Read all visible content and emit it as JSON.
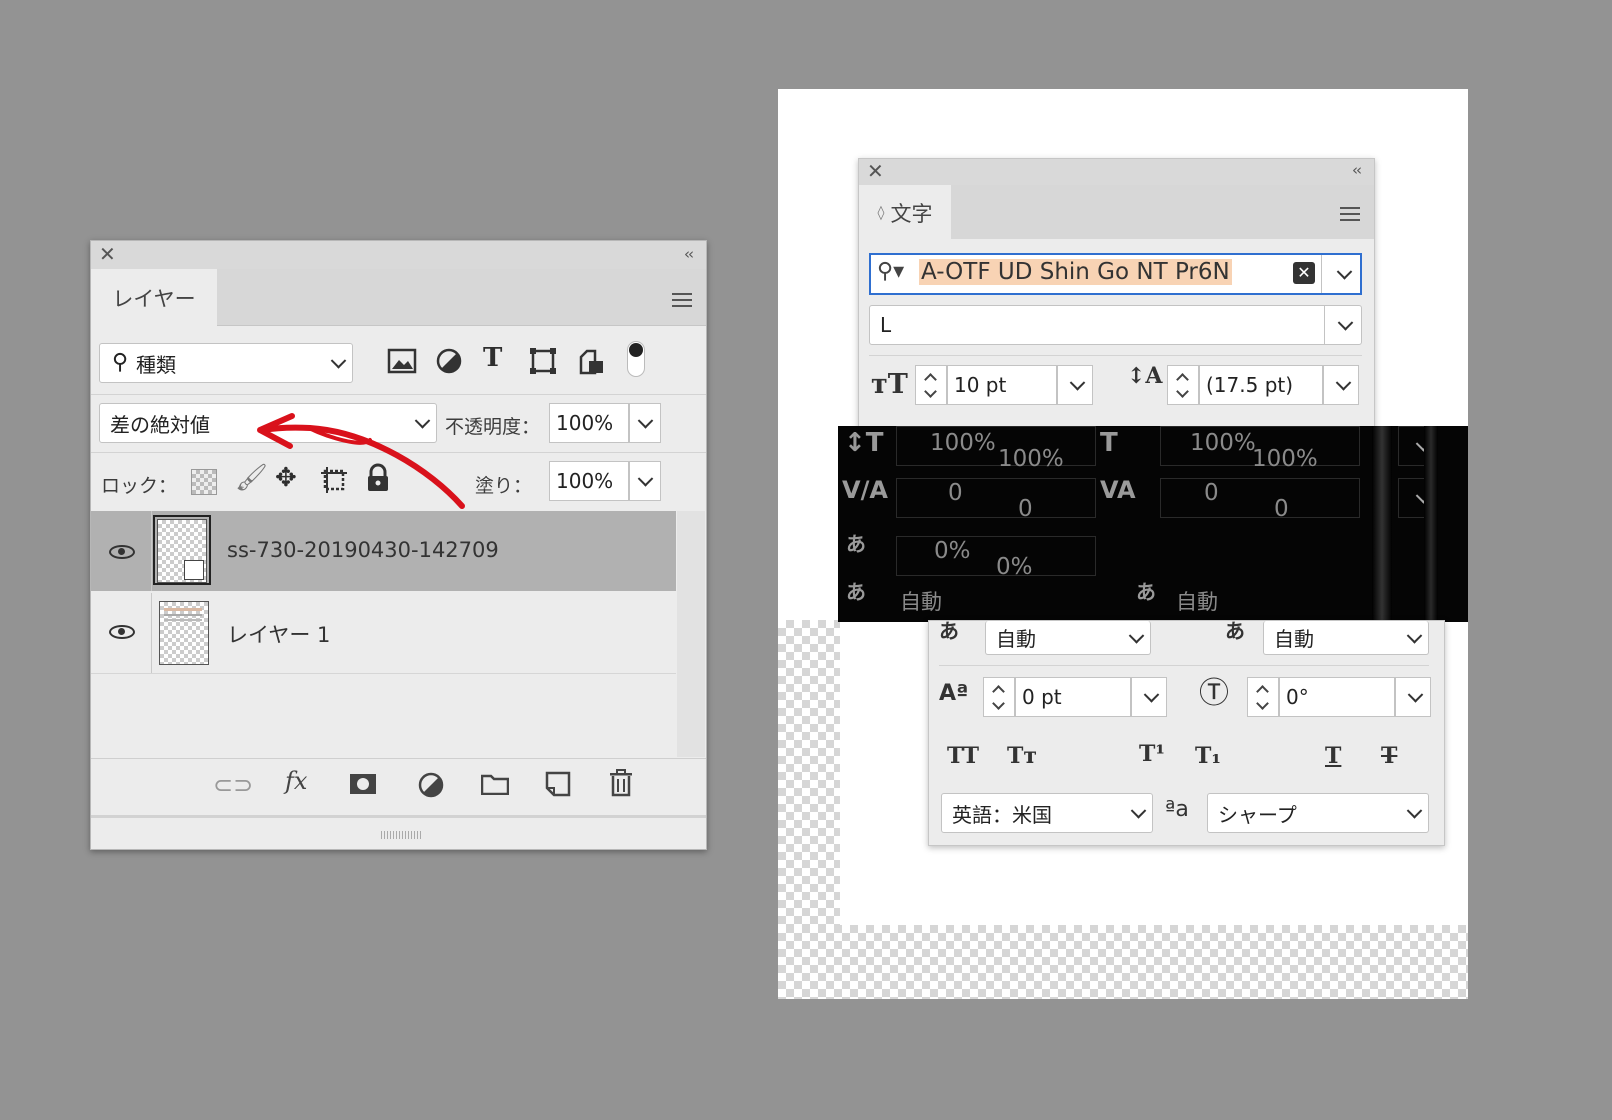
{
  "layers_panel": {
    "close_glyph": "✕",
    "collapse_glyph": "‹‹",
    "tab_label": "レイヤー",
    "filter_label": "種類",
    "blend_mode": "差の絶対値",
    "opacity_label": "不透明度：",
    "opacity_value": "100%",
    "lock_label": "ロック：",
    "fill_label": "塗り：",
    "fill_value": "100%",
    "layers": [
      {
        "name": "ss-730-20190430-142709",
        "selected": true
      },
      {
        "name": "レイヤー 1",
        "selected": false
      }
    ],
    "bottom_fx_label": "fx"
  },
  "character_panel": {
    "close_glyph": "✕",
    "collapse_glyph": "‹‹",
    "tab_label": "文字",
    "font_family": "A-OTF UD Shin Go NT Pr6N",
    "font_style": "L",
    "font_size": "10 pt",
    "leading": "(17.5 pt)",
    "vertical_scale": "100%",
    "horizontal_scale": "100%",
    "kerning": "0",
    "tracking": "0",
    "tsume": "0%",
    "aki_left": "自動",
    "aki_right": "自動",
    "baseline_shift": "0 pt",
    "rotation": "0°",
    "language": "英語：米国",
    "antialias": "シャープ",
    "aa_glyph": "ªa"
  },
  "colors": {
    "background": "#939393",
    "font_highlight": "#f8d3b4",
    "focus_blue": "#2f6fd0",
    "arrow_red": "#d9111b",
    "selected_row": "#b1b1b1"
  }
}
